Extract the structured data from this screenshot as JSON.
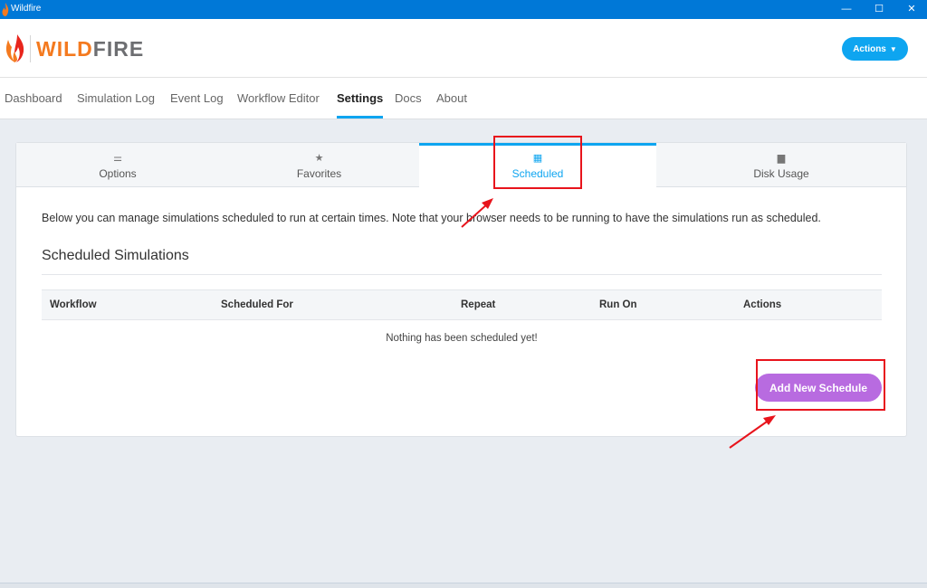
{
  "window": {
    "title": "Wildfire",
    "controls": {
      "minimize": "—",
      "maximize": "☐",
      "close": "✕"
    }
  },
  "header": {
    "logo_wild": "WILD",
    "logo_fire": "FIRE",
    "actions_label": "Actions",
    "actions_caret": "▼",
    "accent": "#0ea5f0",
    "logo_icon": "flame-icon"
  },
  "nav": {
    "items": [
      {
        "label": "Dashboard"
      },
      {
        "label": "Simulation Log"
      },
      {
        "label": "Event Log"
      },
      {
        "label": "Workflow Editor"
      },
      {
        "label": "Settings",
        "active": true
      },
      {
        "label": "Docs"
      },
      {
        "label": "About"
      }
    ]
  },
  "settings": {
    "tabs": [
      {
        "label": "Options",
        "icon": "sliders-icon",
        "glyph": "⚌"
      },
      {
        "label": "Favorites",
        "icon": "star-icon",
        "glyph": "★"
      },
      {
        "label": "Scheduled",
        "icon": "calendar-icon",
        "glyph": "▦",
        "active": true
      },
      {
        "label": "Disk Usage",
        "icon": "hard-drive-icon",
        "glyph": "▆"
      }
    ],
    "description": "Below you can manage simulations scheduled to run at certain times. Note that your browser needs to be running to have the simulations run as scheduled.",
    "section_title": "Scheduled Simulations",
    "table": {
      "columns": [
        "Workflow",
        "Scheduled For",
        "Repeat",
        "Run On",
        "Actions"
      ],
      "rows": [],
      "empty_message": "Nothing has been scheduled yet!"
    },
    "add_button_label": "Add New Schedule",
    "add_button_color": "#b86be0"
  },
  "annotation_color": "#e8141c"
}
